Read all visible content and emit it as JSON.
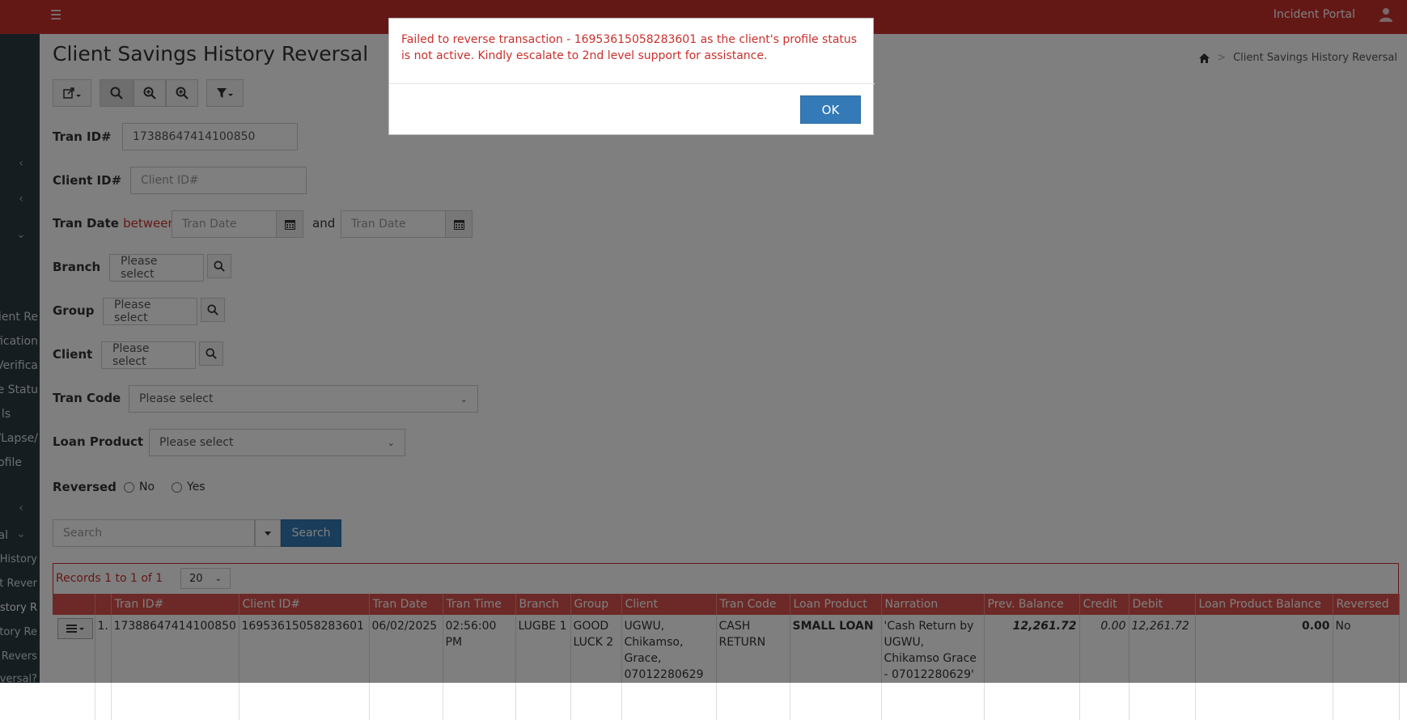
{
  "header": {
    "portal_name": "Incident Portal",
    "menu_icon": "hamburger-icon",
    "user_icon": "user-icon"
  },
  "sidebar": {
    "items": [
      "lient Re",
      "ification",
      "Verifica",
      "e Statu",
      "ls",
      "/Lapse/",
      "ofile",
      "al",
      "History",
      "t Rever",
      "istory R",
      "tory Re",
      "e Revers",
      "versal?"
    ]
  },
  "page": {
    "title": "Client Savings History Reversal",
    "breadcrumb": {
      "home_icon": "home-icon",
      "current": "Client Savings History Reversal"
    }
  },
  "toolbar": {
    "icons": [
      "export-icon",
      "search-icon",
      "zoom-in-icon",
      "zoom-in-icon",
      "filter-icon"
    ]
  },
  "form": {
    "tran_id": {
      "label": "Tran ID#",
      "value": "17388647414100850"
    },
    "client_id": {
      "label": "Client ID#",
      "placeholder": "Client ID#"
    },
    "tran_date": {
      "label": "Tran Date",
      "between": "between",
      "and": "and",
      "from_placeholder": "Tran Date",
      "to_placeholder": "Tran Date"
    },
    "branch": {
      "label": "Branch",
      "value": "Please select"
    },
    "group": {
      "label": "Group",
      "value": "Please select"
    },
    "client": {
      "label": "Client",
      "value": "Please select"
    },
    "tran_code": {
      "label": "Tran Code",
      "value": "Please select"
    },
    "loan_product": {
      "label": "Loan Product",
      "value": "Please select"
    },
    "reversed": {
      "label": "Reversed",
      "options": [
        "No",
        "Yes"
      ]
    },
    "search_placeholder": "Search",
    "search_button": "Search"
  },
  "grid": {
    "records_text": "Records 1 to 1 of 1",
    "page_size": "20",
    "columns": [
      "",
      "",
      "Tran ID#",
      "Client ID#",
      "Tran Date",
      "Tran Time",
      "Branch",
      "Group",
      "Client",
      "Tran Code",
      "Loan Product",
      "Narration",
      "Prev. Balance",
      "Credit",
      "Debit",
      "Loan Product Balance",
      "Reversed"
    ],
    "rows": [
      {
        "index": "1.",
        "tran_id": "17388647414100850",
        "client_id": "16953615058283601",
        "tran_date": "06/02/2025",
        "tran_time": "02:56:00 PM",
        "branch": "LUGBE 1",
        "group": "GOOD LUCK 2",
        "client": "UGWU, Chikamso, Grace, 07012280629",
        "tran_code": "CASH RETURN",
        "loan_product": "SMALL LOAN",
        "narration": "'Cash Return by UGWU, Chikamso Grace - 07012280629'",
        "prev_balance": "12,261.72",
        "credit": "0.00",
        "debit": "12,261.72",
        "loan_product_balance": "0.00",
        "reversed": "No"
      }
    ]
  },
  "modal": {
    "message": "Failed to reverse transaction - 16953615058283601 as the client's profile status is not active. Kindly escalate to 2nd level support for assistance.",
    "ok_label": "OK"
  }
}
